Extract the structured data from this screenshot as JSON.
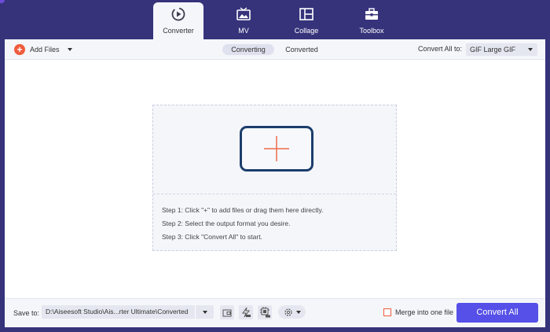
{
  "colors": {
    "background": "#36337b",
    "accent": "#5650e8",
    "add_icon": "#ee5d3e",
    "plus_box_border": "#1c3d6d"
  },
  "nav": {
    "tabs": [
      {
        "label": "Converter",
        "icon": "converter-icon",
        "active": true
      },
      {
        "label": "MV",
        "icon": "mv-icon",
        "active": false
      },
      {
        "label": "Collage",
        "icon": "collage-icon",
        "active": false
      },
      {
        "label": "Toolbox",
        "icon": "toolbox-icon",
        "active": false
      }
    ]
  },
  "toolbar": {
    "add_files_label": "Add Files",
    "segments": [
      {
        "label": "Converting",
        "active": true
      },
      {
        "label": "Converted",
        "active": false
      }
    ],
    "convert_all_to_label": "Convert All to:",
    "format_value": "GIF Large GIF"
  },
  "dropzone": {
    "steps": [
      "Step 1: Click \"+\" to add files or drag them here directly.",
      "Step 2: Select the output format you desire.",
      "Step 3: Click \"Convert All\" to start."
    ]
  },
  "bottom": {
    "save_to_label": "Save to:",
    "save_path": "D:\\Aiseesoft Studio\\Ais...rter Ultimate\\Converted",
    "merge_label": "Merge into one file",
    "merge_checked": false,
    "convert_all_label": "Convert All"
  }
}
